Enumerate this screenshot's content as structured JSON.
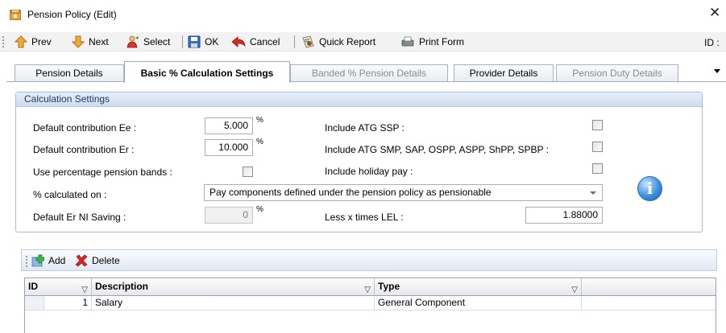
{
  "window": {
    "title": "Pension Policy (Edit)",
    "close_glyph": "✕"
  },
  "toolbar": {
    "prev_label": "Prev",
    "next_label": "Next",
    "select_label": "Select",
    "ok_label": "OK",
    "cancel_label": "Cancel",
    "quick_report_label": "Quick Report",
    "print_form_label": "Print Form",
    "id_label": "ID :"
  },
  "tabs": [
    {
      "label": "Pension Details",
      "state": "normal"
    },
    {
      "label": "Basic % Calculation Settings",
      "state": "active"
    },
    {
      "label": "Banded % Pension Details",
      "state": "disabled"
    },
    {
      "label": "Provider Details",
      "state": "normal"
    },
    {
      "label": "Pension Duty Details",
      "state": "disabled"
    }
  ],
  "calc": {
    "group_title": "Calculation Settings",
    "ee_label": "Default contribution  Ee :",
    "ee_value": "5.000",
    "er_label": "Default contribution  Er :",
    "er_value": "10.000",
    "pct_symbol": "%",
    "bands_label": "Use percentage pension bands :",
    "calc_on_label": "% calculated on :",
    "calc_on_value": "Pay components defined under the pension policy as pensionable",
    "ni_label": "Default Er NI Saving :",
    "ni_value": "0",
    "atg_ssp_label": "Include ATG SSP :",
    "atg_smp_label": "Include ATG SMP, SAP, OSPP, ASPP, ShPP, SPBP :",
    "holiday_label": "Include holiday pay :",
    "lel_label": "Less x times LEL :",
    "lel_value": "1.88000",
    "info_glyph": "i"
  },
  "grid_toolbar": {
    "add_label": "Add",
    "delete_label": "Delete"
  },
  "grid": {
    "columns": [
      "ID",
      "Description",
      "Type"
    ],
    "rows": [
      {
        "id": "1",
        "description": "Salary",
        "type": "General Component"
      }
    ]
  },
  "colors": {
    "accent": "#3d91de",
    "tab_border": "#9aaec9",
    "group_header": "#cfdcee"
  },
  "icons": [
    "app-icon",
    "up-arrow-icon",
    "down-arrow-icon",
    "select-person-icon",
    "save-disk-icon",
    "cancel-back-arrow-icon",
    "report-icon",
    "print-form-icon",
    "info-icon",
    "add-icon",
    "delete-x-icon",
    "filter-icon",
    "dropdown-arrow-icon"
  ]
}
